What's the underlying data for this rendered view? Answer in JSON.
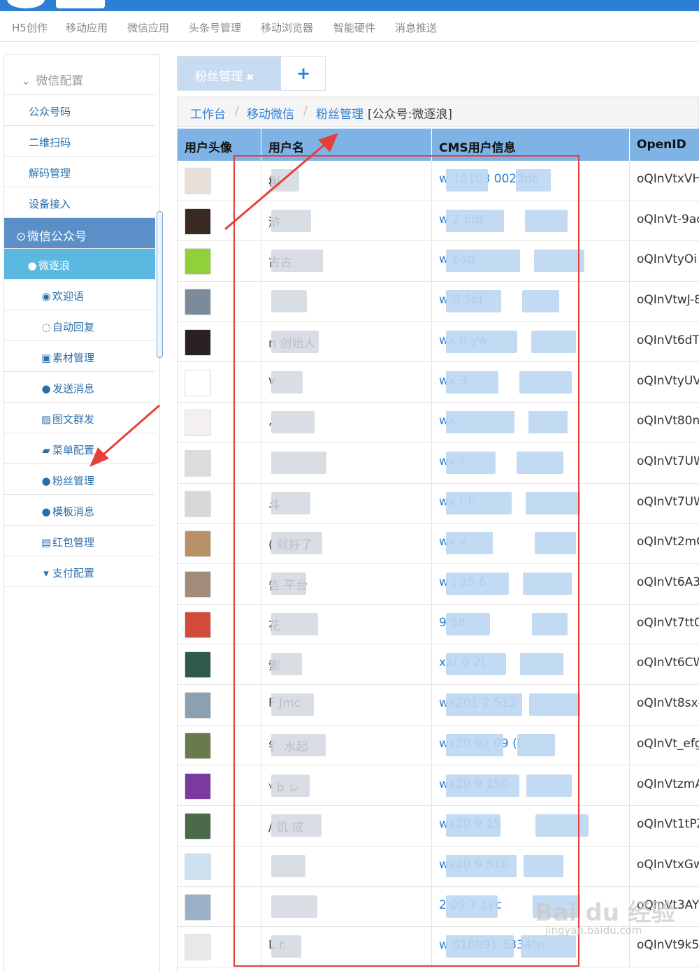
{
  "topnav": [
    "H5创作",
    "移动应用",
    "微信应用",
    "头条号管理",
    "移动浏览器",
    "智能硬件",
    "消息推送"
  ],
  "sidebar": {
    "header": "微信配置",
    "items": [
      "公众号码",
      "二维扫码",
      "解码管理",
      "设备接入"
    ],
    "active": "微信公众号",
    "account": "微逐浪",
    "subitems": [
      "欢迎语",
      "自动回复",
      "素材管理",
      "发送消息",
      "图文群发",
      "菜单配置",
      "粉丝管理",
      "模板消息",
      "红包管理",
      "支付配置"
    ]
  },
  "tabs": {
    "active": "粉丝管理",
    "close": "✖",
    "add": "+"
  },
  "breadcrumb": {
    "home": "工作台",
    "sep": "/",
    "mid": "移动微信",
    "current": "粉丝管理",
    "suffix": "[公众号:微逐浪]"
  },
  "table": {
    "headers": [
      "用户头像",
      "用户名",
      "CMS用户信息",
      "OpenID"
    ],
    "rows": [
      {
        "name": "槲",
        "cms": "w    18103    0023do",
        "openid": "oQInVtxVH"
      },
      {
        "name": "浒",
        "cms": "w         2        6dt",
        "openid": "oQInVt-9ac"
      },
      {
        "name": "      古古",
        "cms": "w                  6ad",
        "openid": "oQInVtyOi"
      },
      {
        "name": "",
        "cms": "w        0        5bj",
        "openid": "oQInVtwJ-8"
      },
      {
        "name": "п       创始人",
        "cms": "wx       0          yw",
        "openid": "oQInVt6dT"
      },
      {
        "name": "         v",
        "cms": "wx                   3",
        "openid": "oQInVtyUV"
      },
      {
        "name": "        ,",
        "cms": "wx                    .",
        "openid": "oQInVt80n"
      },
      {
        "name": "",
        "cms": "wx        )",
        "openid": "oQInVt7UW"
      },
      {
        "name": "     斗",
        "cms": "wx        (           h",
        "openid": "oQInVt7UW"
      },
      {
        "name": "     (    就好了",
        "cms": "wx                   v",
        "openid": "oQInVt2mC"
      },
      {
        "name": "  告  平台",
        "cms": "w       J     35    6",
        "openid": "oQInVt6A3"
      },
      {
        "name": "           花",
        "cms": "       9      58",
        "openid": "oQInVt7tt0"
      },
      {
        "name": "索",
        "cms": "x2(     0     2(",
        "openid": "oQInVt6CW"
      },
      {
        "name": "F   Jmc",
        "cms": "wx201      2    513",
        "openid": "oQInVt8sxg"
      },
      {
        "name": "钅    水起",
        "cms": "wx20     92    09    ((",
        "openid": "oQInVt_efg"
      },
      {
        "name": "ᵞ   b    レ",
        "cms": "wx20     9    150",
        "openid": "oQInVtzmA"
      },
      {
        "name": "/     饥       成",
        "cms": "wx20      9    15",
        "openid": "oQInVt1tPZ"
      },
      {
        "name": "",
        "cms": "wx20     9    510",
        "openid": "oQInVtxGw"
      },
      {
        "name": "",
        "cms": "  2     09    7    1yc",
        "openid": "oQInVt3AY"
      },
      {
        "name": "L      r.",
        "cms": "w    018091     3334tw",
        "openid": "oQInVt9k5"
      }
    ]
  },
  "watermark": {
    "main": "Bai du 经验",
    "sub": "jingyan.baidu.com"
  },
  "colors": {
    "accent": "#2b7fd4",
    "header_bg": "#7fb3e6",
    "sidebar_active": "#5c8fc8",
    "sidebar_sub": "#5bb8e0",
    "annotation": "#e4403b"
  }
}
